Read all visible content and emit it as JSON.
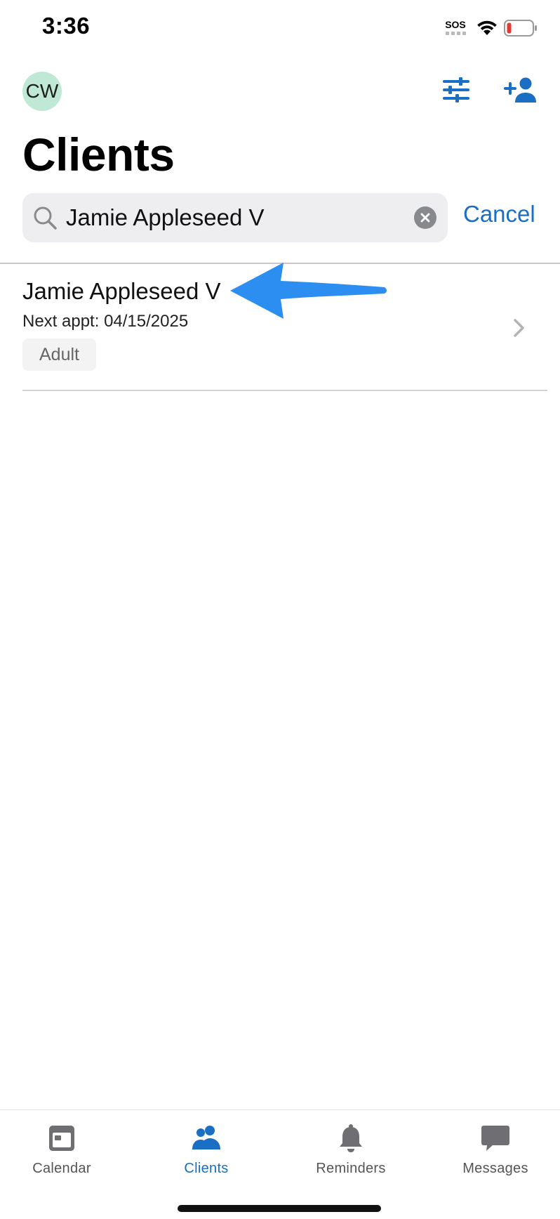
{
  "status_bar": {
    "time": "3:36",
    "sos": "SOS"
  },
  "header": {
    "avatar_initials": "CW",
    "title": "Clients",
    "filter_icon": "sliders-icon",
    "add_icon": "add-person-icon"
  },
  "search": {
    "value": "Jamie Appleseed V",
    "placeholder": "Search",
    "cancel_label": "Cancel"
  },
  "results": [
    {
      "name": "Jamie Appleseed V",
      "next_appt": "Next appt: 04/15/2025",
      "badge": "Adult"
    }
  ],
  "tabs": [
    {
      "label": "Calendar",
      "icon": "calendar-icon",
      "active": false
    },
    {
      "label": "Clients",
      "icon": "people-icon",
      "active": true
    },
    {
      "label": "Reminders",
      "icon": "bell-icon",
      "active": false
    },
    {
      "label": "Messages",
      "icon": "chat-icon",
      "active": false
    }
  ],
  "colors": {
    "accent": "#1a6fc4",
    "avatar_bg": "#bfe9d6",
    "arrow_annotation": "#2b8ef0",
    "battery_low": "#e53935"
  }
}
